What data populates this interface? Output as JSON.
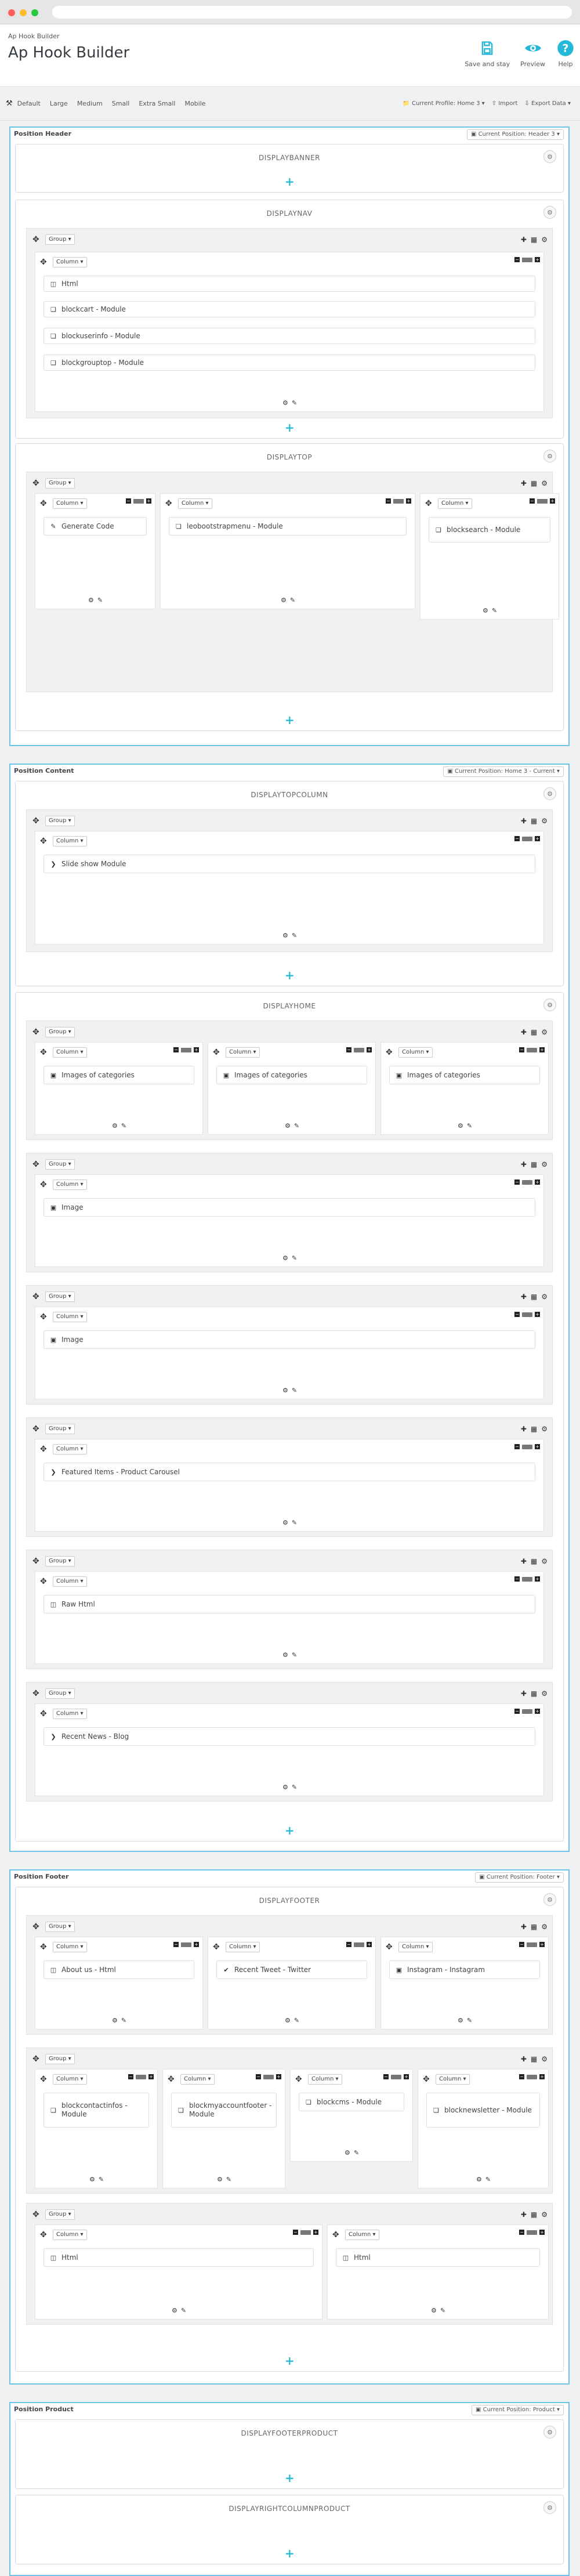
{
  "header": {
    "breadcrumb": "Ap Hook Builder",
    "title": "Ap Hook Builder",
    "buttons": [
      {
        "label": "Save and stay",
        "icon": "save-icon"
      },
      {
        "label": "Preview",
        "icon": "eye-icon"
      },
      {
        "label": "Help",
        "icon": "help-icon"
      }
    ]
  },
  "toolbar": {
    "devices": [
      "Default",
      "Large",
      "Medium",
      "Small",
      "Extra Small",
      "Mobile"
    ],
    "profile": "Current Profile: Home 3",
    "import": "Import",
    "export": "Export Data"
  },
  "positions": {
    "header": {
      "title": "Position Header",
      "dropdown": "Current Position: Header 3",
      "hooks": {
        "banner": "DISPLAYBANNER",
        "nav": "DISPLAYNAV",
        "top": "DISPLAYTOP"
      }
    },
    "content": {
      "title": "Position Content",
      "dropdown": "Current Position: Home 3 - Current",
      "hooks": {
        "topcolumn": "DISPLAYTOPCOLUMN",
        "home": "DISPLAYHOME"
      }
    },
    "footer": {
      "title": "Position Footer",
      "dropdown": "Current Position: Footer",
      "hooks": {
        "footer": "DISPLAYFOOTER"
      }
    },
    "product": {
      "title": "Position Product",
      "dropdown": "Current Position: Product",
      "hooks": {
        "footerproduct": "DISPLAYFOOTERPRODUCT",
        "rightcolumn": "DISPLAYRIGHTCOLUMNPRODUCT"
      }
    }
  },
  "labels": {
    "group": "Group",
    "column": "Column"
  },
  "modules": {
    "html": "Html",
    "blockcart": "blockcart - Module",
    "blockuserinfo": "blockuserinfo - Module",
    "blockgrouptop": "blockgrouptop - Module",
    "generate_code": "Generate Code",
    "leobootstrapmenu": "leobootstrapmenu - Module",
    "blocksearch": "blocksearch - Module",
    "slideshow": "Slide show Module",
    "images_of_categories": "Images of categories",
    "image": "Image",
    "featured": "Featured Items - Product Carousel",
    "raw_html": "Raw Html",
    "recent_news": "Recent News - Blog",
    "about_us": "About us - Html",
    "recent_tweet": "Recent Tweet - Twitter",
    "instagram": "Instagram - Instagram",
    "blockcontactinfos": "blockcontactinfos - Module",
    "blockmyaccountfooter": "blockmyaccountfooter - Module",
    "blockcms": "blockcms - Module",
    "blocknewsletter": "blocknewsletter - Module"
  },
  "colors": {
    "accent": "#25b9d7",
    "border": "#6ec3e8"
  }
}
